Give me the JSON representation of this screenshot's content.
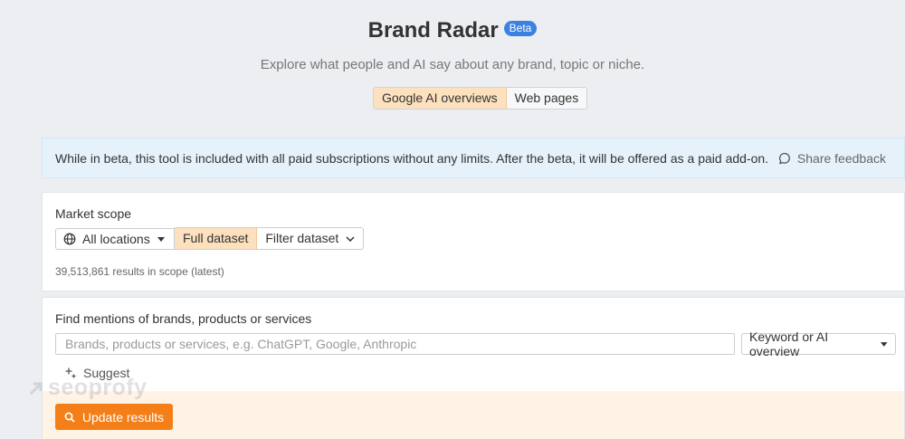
{
  "header": {
    "title": "Brand Radar",
    "badge": "Beta",
    "subtitle": "Explore what people and AI say about any brand, topic or niche.",
    "modes": [
      {
        "label": "Google AI overviews",
        "active": true
      },
      {
        "label": "Web pages",
        "active": false
      }
    ]
  },
  "banner": {
    "text": "While in beta, this tool is included with all paid subscriptions without any limits. After the beta, it will be offered as a paid add-on.",
    "feedback_label": "Share feedback",
    "feedback_icon": "chat-bubble-icon"
  },
  "scope": {
    "label": "Market scope",
    "location_label": "All locations",
    "dataset_options": [
      {
        "label": "Full dataset",
        "active": true
      },
      {
        "label": "Filter dataset",
        "active": false
      }
    ],
    "count_text": "39,513,861 results in scope (latest)"
  },
  "search": {
    "label": "Find mentions of brands, products or services",
    "placeholder": "Brands, products or services, e.g. ChatGPT, Google, Anthropic",
    "value": "",
    "mode_label": "Keyword or AI overview",
    "suggest_label": "Suggest",
    "update_label": "Update results"
  },
  "watermark": "seoprofy",
  "colors": {
    "accent": "#f47e18",
    "active_segment": "#fde0bd",
    "badge": "#3b82e0",
    "banner_bg": "#e6f2fb"
  }
}
